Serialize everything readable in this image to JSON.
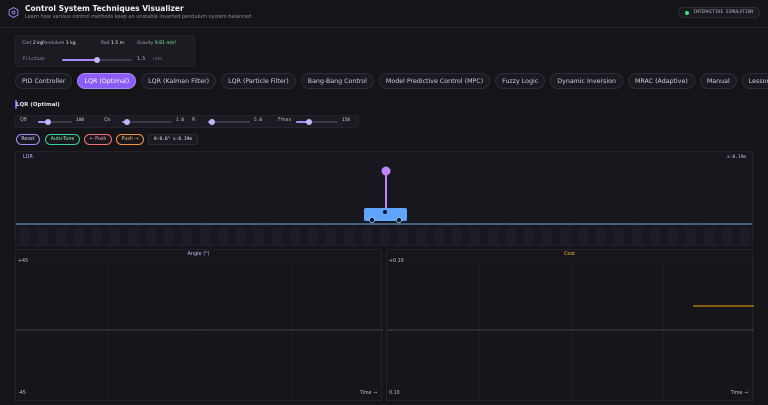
{
  "header": {
    "title": "Control System Techniques Visualizer",
    "subtitle": "Learn how various control methods keep an unstable inverted pendulum system balanced",
    "badge": "INTERACTIVE SIMULATION",
    "badge_color": "#4ade80"
  },
  "params": {
    "cart_label": "Cart",
    "cart_value": "2 kg",
    "pendulum_label": "Pendulum",
    "pendulum_value": "1 kg",
    "rod_label": "Rod",
    "rod_value": "1.5 m",
    "gravity_label": "Gravity",
    "gravity_value": "9.81 m/s²",
    "friction_label": "Friction",
    "friction_value": "1.5",
    "friction_unit": "rate",
    "friction_level": 0.5
  },
  "tabs": [
    {
      "label": "PID Controller",
      "active": false
    },
    {
      "label": "LQR (Optimal)",
      "active": true
    },
    {
      "label": "LQR (Kalman Filter)",
      "active": false
    },
    {
      "label": "LQR (Particle Filter)",
      "active": false
    },
    {
      "label": "Bang-Bang Control",
      "active": false
    },
    {
      "label": "Model Predictive Control (MPC)",
      "active": false
    },
    {
      "label": "Fuzzy Logic",
      "active": false
    },
    {
      "label": "Dynamic Inversion",
      "active": false
    },
    {
      "label": "MRAC (Adaptive)",
      "active": false
    },
    {
      "label": "Manual",
      "active": false
    },
    {
      "label": "Lessons",
      "active": false
    }
  ],
  "controller": {
    "name": "LQR (Optimal)",
    "gains": [
      {
        "label": "Qθ",
        "value": "100",
        "level": 0.3
      },
      {
        "label": "Qx",
        "value": "1.0",
        "level": 0.1
      },
      {
        "label": "R",
        "value": "5.0",
        "level": 0.1
      },
      {
        "label": "Fmax",
        "value": "150",
        "level": 0.3
      }
    ]
  },
  "controls": {
    "reset": "Reset",
    "autotune": "Auto-Tune",
    "push_left": "← Push",
    "push_right": "Push →",
    "readout": "θ:0.0° x:0.19m"
  },
  "simulation": {
    "label": "LQR",
    "position": "x:0.19m",
    "cart_color": "#60a5fa",
    "pendulum_color": "#c084fc"
  },
  "plots": {
    "angle": {
      "title": "Angle (°)",
      "ymax": "+45",
      "ymin": "-45",
      "xlabel": "Time →",
      "color": "#a78bfa"
    },
    "cost": {
      "title": "Cost",
      "ymax": "+0.10",
      "ymin": "0.10",
      "xlabel": "Time →",
      "color": "#f59e0b"
    }
  }
}
